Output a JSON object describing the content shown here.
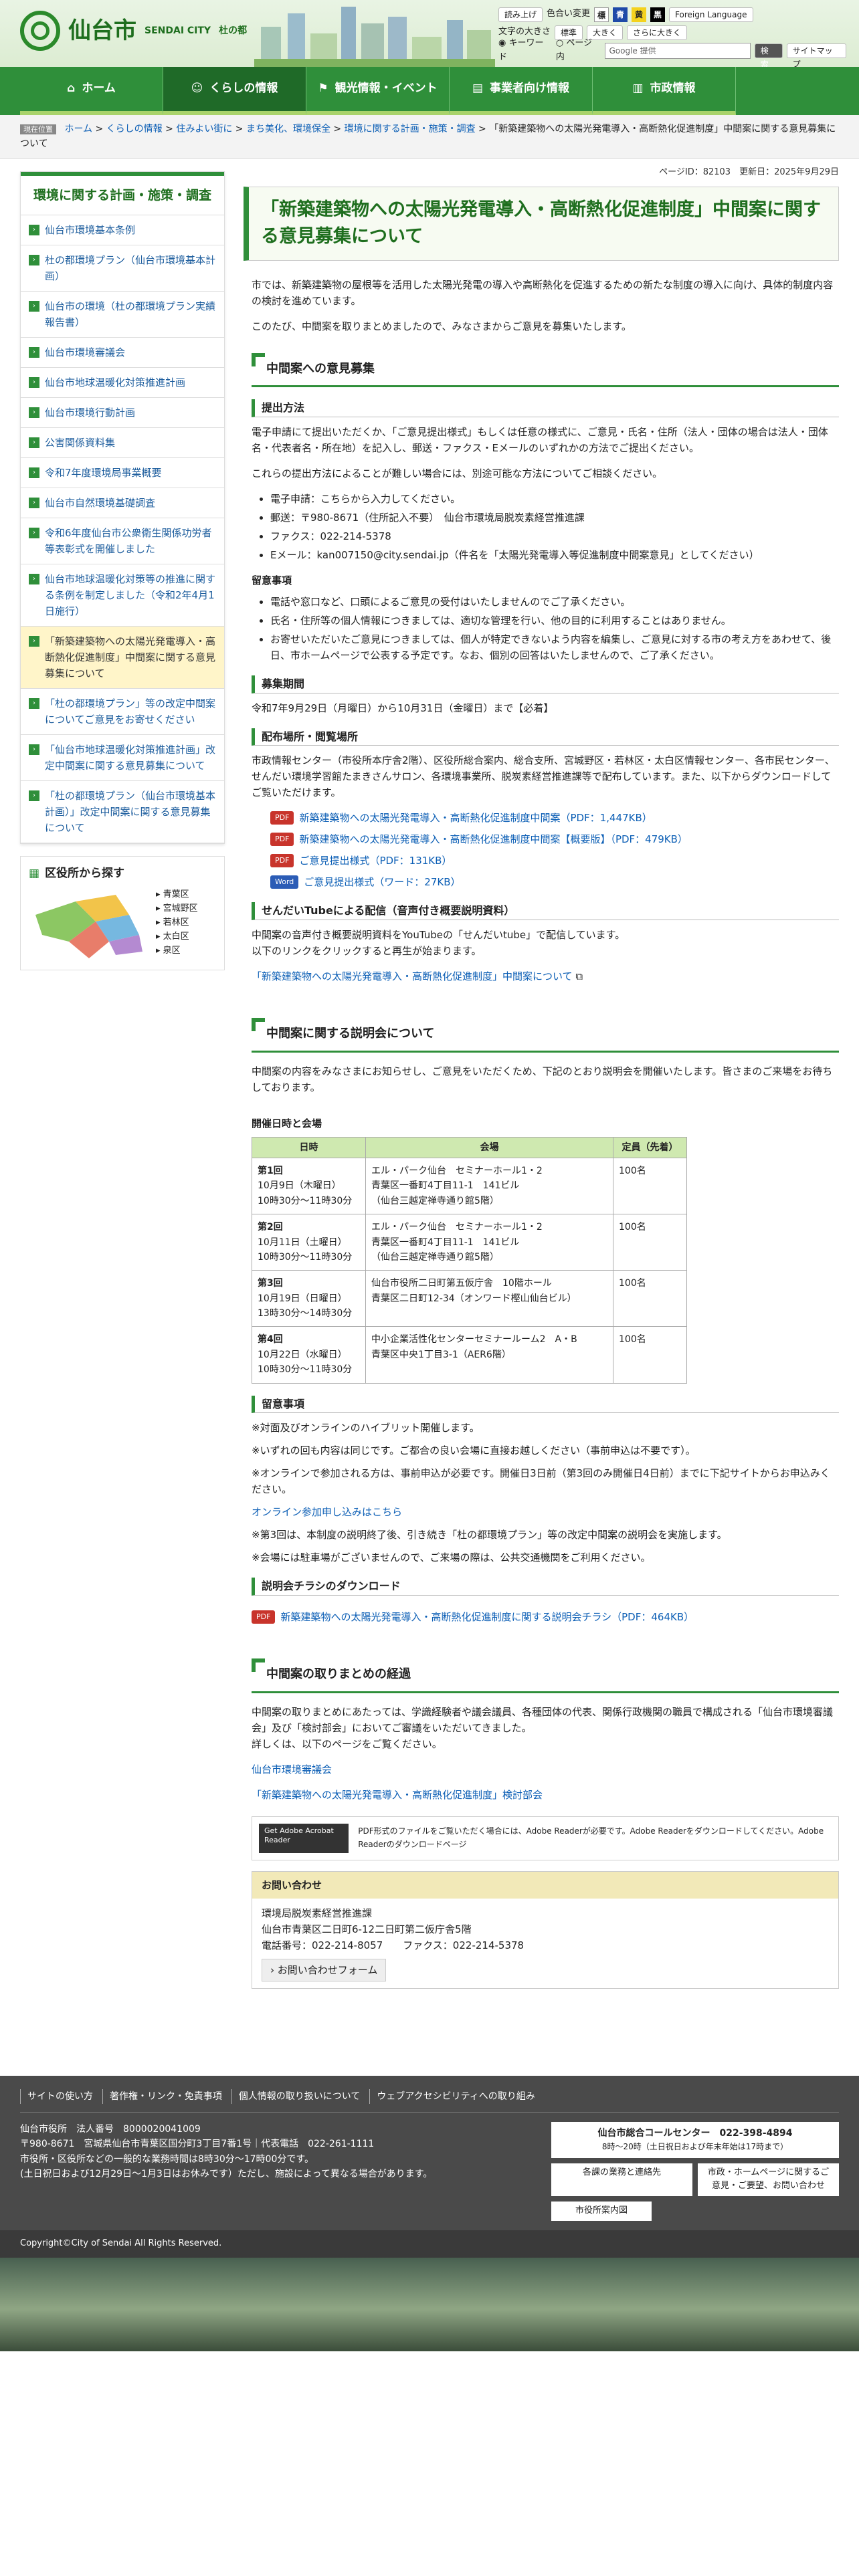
{
  "header": {
    "logo_name": "仙台市",
    "logo_en": "SENDAI CITY",
    "logo_tag": "杜の都",
    "read": "読み上げ",
    "color_change": "色合い変更",
    "color_std": "標準",
    "color_blue": "青",
    "color_yellow": "黄",
    "color_black": "黒",
    "foreign": "Foreign Language",
    "font_size": "文字の大きさ",
    "font_std": "標準",
    "font_big": "大きく",
    "font_bigger": "さらに大きく",
    "search_keyword": "キーワード",
    "search_page": "ページ内",
    "search_placeholder": "Google 提供",
    "search_btn": "検索",
    "sitemap": "サイトマップ"
  },
  "nav": [
    "ホーム",
    "くらしの情報",
    "観光情報・イベント",
    "事業者向け情報",
    "市政情報"
  ],
  "breadcrumb": {
    "here": "現在位置",
    "items": [
      "ホーム",
      "くらしの情報",
      "住みよい街に",
      "まち美化、環境保全",
      "環境に関する計画・施策・調査"
    ],
    "current": "「新築建築物への太陽光発電導入・高断熱化促進制度」中間案に関する意見募集について"
  },
  "meta": {
    "page_id": "ページID：82103",
    "updated": "更新日：2025年9月29日"
  },
  "sidebar": {
    "title": "環境に関する計画・施策・調査",
    "items": [
      "仙台市環境基本条例",
      "杜の都環境プラン（仙台市環境基本計画）",
      "仙台市の環境（杜の都環境プラン実績報告書）",
      "仙台市環境審議会",
      "仙台市地球温暖化対策推進計画",
      "仙台市環境行動計画",
      "公害関係資料集",
      "令和7年度環境局事業概要",
      "仙台市自然環境基礎調査",
      "令和6年度仙台市公衆衛生関係功労者等表彰式を開催しました",
      "仙台市地球温暖化対策等の推進に関する条例を制定しました（令和2年4月1日施行）",
      "「新築建築物への太陽光発電導入・高断熱化促進制度」中間案に関する意見募集について",
      "「杜の都環境プラン」等の改定中間案についてご意見をお寄せください",
      "「仙台市地球温暖化対策推進計画」改定中間案に関する意見募集について",
      "「杜の都環境プラン（仙台市環境基本計画）」改定中間案に関する意見募集について"
    ],
    "map_title": "区役所から探す",
    "wards": [
      "青葉区",
      "宮城野区",
      "若林区",
      "太白区",
      "泉区"
    ]
  },
  "content": {
    "title": "「新築建築物への太陽光発電導入・高断熱化促進制度」中間案に関する意見募集について",
    "intro1": "市では、新築建築物の屋根等を活用した太陽光発電の導入や高断熱化を促進するための新たな制度の導入に向け、具体的制度内容の検討を進めています。",
    "intro2": "このたび、中間案を取りまとめましたので、みなさまからご意見を募集いたします。",
    "s1": "中間案への意見募集",
    "s1_method": "提出方法",
    "s1_p1": "電子申請にて提出いただくか、「ご意見提出様式」もしくは任意の様式に、ご意見・氏名・住所（法人・団体の場合は法人・団体名・代表者名・所在地）を記入し、郵送・ファクス・Eメールのいずれかの方法でご提出ください。",
    "s1_p2": "これらの提出方法によることが難しい場合には、別途可能な方法についてご相談ください。",
    "s1_list": [
      "電子申請：こちらから入力してください。",
      "郵送：〒980-8671（住所記入不要）　仙台市環境局脱炭素経営推進課",
      "ファクス：022-214-5378",
      "Eメール：kan007150@city.sendai.jp（件名を「太陽光発電導入等促進制度中間案意見」としてください）"
    ],
    "s1_notes_title": "留意事項",
    "s1_notes": [
      "電話や窓口など、口頭によるご意見の受付はいたしませんのでご了承ください。",
      "氏名・住所等の個人情報につきましては、適切な管理を行い、他の目的に利用することはありません。",
      "お寄せいただいたご意見につきましては、個人が特定できないよう内容を編集し、ご意見に対する市の考え方をあわせて、後日、市ホームページで公表する予定です。なお、個別の回答はいたしませんので、ご了承ください。"
    ],
    "s1_period_title": "募集期間",
    "s1_period": "令和7年9月29日（月曜日）から10月31日（金曜日）まで【必着】",
    "s1_place_title": "配布場所・閲覧場所",
    "s1_place": "市政情報センター（市役所本庁舎2階）、区役所総合案内、総合支所、宮城野区・若林区・太白区情報センター、各市民センター、せんだい環境学習館たまきさんサロン、各環境事業所、脱炭素経営推進課等で配布しています。また、以下からダウンロードしてご覧いただけます。",
    "files": [
      {
        "type": "PDF",
        "label": "新築建築物への太陽光発電導入・高断熱化促進制度中間案（PDF：1,447KB）"
      },
      {
        "type": "PDF",
        "label": "新築建築物への太陽光発電導入・高断熱化促進制度中間案【概要版】（PDF：479KB）"
      },
      {
        "type": "PDF",
        "label": "ご意見提出様式（PDF：131KB）"
      },
      {
        "type": "Word",
        "label": "ご意見提出様式（ワード：27KB）"
      }
    ],
    "s1_tube_title": "せんだいTubeによる配信（音声付き概要説明資料）",
    "s1_tube1": "中間案の音声付き概要説明資料をYouTubeの「せんだいtube」で配信しています。",
    "s1_tube2": "以下のリンクをクリックすると再生が始まります。",
    "s1_tube_link": "「新築建築物への太陽光発電導入・高断熱化促進制度」中間案について",
    "s2": "中間案に関する説明会について",
    "s2_p": "中間案の内容をみなさまにお知らせし、ご意見をいただくため、下記のとおり説明会を開催いたします。皆さまのご来場をお待ちしております。",
    "s2_table_title": "開催日時と会場",
    "table_headers": [
      "日時",
      "会場",
      "定員（先着）"
    ],
    "table_rows": [
      [
        "第1回",
        "10月9日（木曜日）\n10時30分～11時30分",
        "エル・パーク仙台　セミナーホール1・2\n青葉区一番町4丁目11-1　141ビル\n（仙台三越定禅寺通り館5階）",
        "100名"
      ],
      [
        "第2回",
        "10月11日（土曜日）\n10時30分～11時30分",
        "エル・パーク仙台　セミナーホール1・2\n青葉区一番町4丁目11-1　141ビル\n（仙台三越定禅寺通り館5階）",
        "100名"
      ],
      [
        "第3回",
        "10月19日（日曜日）\n13時30分～14時30分",
        "仙台市役所二日町第五仮庁舎　10階ホール\n青葉区二日町12-34（オンワード樫山仙台ビル）",
        "100名"
      ],
      [
        "第4回",
        "10月22日（水曜日）\n10時30分～11時30分",
        "中小企業活性化センターセミナールーム2　A・B\n青葉区中央1丁目3-1（AER6階）",
        "100名"
      ]
    ],
    "s2_notes_title": "留意事項",
    "s2_notes": [
      "※対面及びオンラインのハイブリット開催します。",
      "※いずれの回も内容は同じです。ご都合の良い会場に直接お越しください（事前申込は不要です）。",
      "※オンラインで参加される方は、事前申込が必要です。開催日3日前（第3回のみ開催日4日前）までに下記サイトからお申込みください。",
      "オンライン参加申し込みはこちら",
      "※第3回は、本制度の説明終了後、引き続き「杜の都環境プラン」等の改定中間案の説明会を実施します。",
      "※会場には駐車場がございませんので、ご来場の際は、公共交通機関をご利用ください。"
    ],
    "s2_flyer_title": "説明会チラシのダウンロード",
    "s2_flyer": "新築建築物への太陽光発電導入・高断熱化促進制度に関する説明会チラシ（PDF：464KB）",
    "s3": "中間案の取りまとめの経過",
    "s3_p1": "中間案の取りまとめにあたっては、学識経験者や議会議員、各種団体の代表、関係行政機関の職員で構成される「仙台市環境審議会」及び「検討部会」においてご審議をいただいてきました。",
    "s3_p2": "詳しくは、以下のページをご覧ください。",
    "s3_link1": "仙台市環境審議会",
    "s3_link2": "「新築建築物への太陽光発電導入・高断熱化促進制度」検討部会",
    "adobe_btn": "Get Adobe Acrobat Reader",
    "adobe_text": "PDF形式のファイルをご覧いただく場合には、Adobe Readerが必要です。Adobe Readerをダウンロードしてください。Adobe Readerのダウンロードページ",
    "contact_title": "お問い合わせ",
    "contact_lines": [
      "環境局脱炭素経営推進課",
      "仙台市青葉区二日町6-12二日町第二仮庁舎5階",
      "電話番号：022-214-8057　　ファクス：022-214-5378"
    ],
    "contact_btn": "お問い合わせフォーム"
  },
  "footer": {
    "links": [
      "サイトの使い方",
      "著作権・リンク・免責事項",
      "個人情報の取り扱いについて",
      "ウェブアクセシビリティへの取り組み"
    ],
    "lines": [
      "仙台市役所　法人番号　8000020041009",
      "〒980-8671　宮城県仙台市青葉区国分町3丁目7番1号｜代表電話　022-261-1111",
      "市役所・区役所などの一般的な業務時間は8時30分～17時00分です。",
      "(土日祝日および12月29日～1月3日はお休みです）ただし、施設によって異なる場合があります。"
    ],
    "call": "仙台市総合コールセンター　022-398-4894",
    "call_hours": "8時～20時（土日祝日および年末年始は17時まで）",
    "btns": [
      "各課の業務と連絡先",
      "市役所案内図",
      "市政・ホームページに関するご意見・ご要望、お問い合わせ"
    ],
    "copyright": "Copyright©City of Sendai All Rights Reserved."
  },
  "colors": {
    "green": "#2f8f3a",
    "dark_green": "#1e6e1e"
  }
}
